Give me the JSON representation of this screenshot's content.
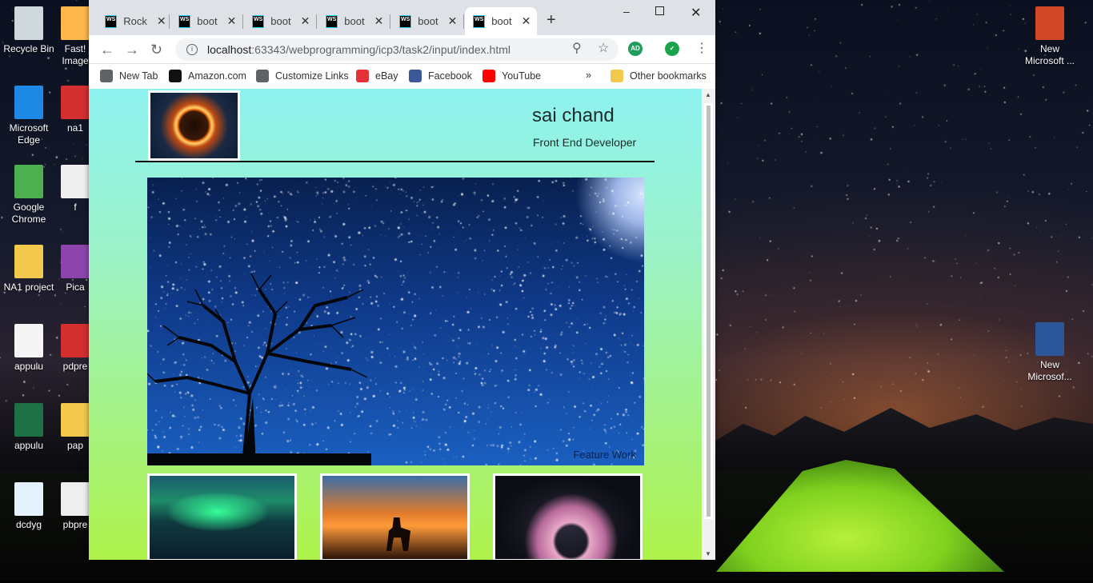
{
  "desktop": {
    "icons_left": [
      {
        "label": "Recycle Bin",
        "icon": "recycle-bin-icon",
        "color": "#cfd8dc"
      },
      {
        "label": "Microsoft Edge",
        "icon": "edge-icon",
        "color": "#1e88e5"
      },
      {
        "label": "Google Chrome",
        "icon": "chrome-icon",
        "color": "#4caf50"
      },
      {
        "label": "NA1 project",
        "icon": "folder-icon",
        "color": "#f2c94c"
      },
      {
        "label": "appulu",
        "icon": "text-file-icon",
        "color": "#f5f5f5"
      },
      {
        "label": "appulu",
        "icon": "excel-icon",
        "color": "#1e7145"
      },
      {
        "label": "dcdyg",
        "icon": "image-file-icon",
        "color": "#e3f2fd"
      }
    ],
    "icons_second_column": [
      {
        "label": "Fast! Image",
        "icon": "app-icon",
        "color": "#ffb74d"
      },
      {
        "label": "na1",
        "icon": "pdf-icon",
        "color": "#d32f2f"
      },
      {
        "label": "f",
        "icon": "file-icon",
        "color": "#eeeeee"
      },
      {
        "label": "Pica",
        "icon": "picasa-icon",
        "color": "#8e44ad"
      },
      {
        "label": "pdpre",
        "icon": "pdf-icon",
        "color": "#d32f2f"
      },
      {
        "label": "pap",
        "icon": "folder-icon",
        "color": "#f2c94c"
      },
      {
        "label": "pbpre",
        "icon": "file-icon",
        "color": "#eeeeee"
      }
    ],
    "icons_right": [
      {
        "label": "New Microsoft ...",
        "icon": "powerpoint-icon",
        "color": "#d24726"
      },
      {
        "label": "New Microsof...",
        "icon": "word-icon",
        "color": "#2b579a"
      }
    ]
  },
  "browser": {
    "tabs": [
      {
        "label": "Rock",
        "active": false
      },
      {
        "label": "boot",
        "active": false
      },
      {
        "label": "boot",
        "active": false
      },
      {
        "label": "boot",
        "active": false
      },
      {
        "label": "boot",
        "active": false
      },
      {
        "label": "boot",
        "active": true
      }
    ],
    "tab_icon_text": "WS",
    "url_host": "localhost",
    "url_path": ":63343/webprogramming/icp3/task2/input/index.html",
    "extension_ad": "AD",
    "bookmarks": [
      {
        "label": "New Tab",
        "icon": "globe-icon",
        "color": "#5f6368"
      },
      {
        "label": "Amazon.com",
        "icon": "amazon-icon",
        "color": "#111111"
      },
      {
        "label": "Customize Links",
        "icon": "globe-icon",
        "color": "#5f6368"
      },
      {
        "label": "eBay",
        "icon": "ebay-icon",
        "color": "#e53238"
      },
      {
        "label": "Facebook",
        "icon": "facebook-icon",
        "color": "#3b5998"
      },
      {
        "label": "YouTube",
        "icon": "youtube-icon",
        "color": "#ff0000"
      }
    ],
    "bookmarks_overflow": "»",
    "other_bookmarks": "Other bookmarks"
  },
  "page": {
    "name": "sai chand",
    "role": "Front End Developer",
    "hero_caption": "Feature Work"
  }
}
